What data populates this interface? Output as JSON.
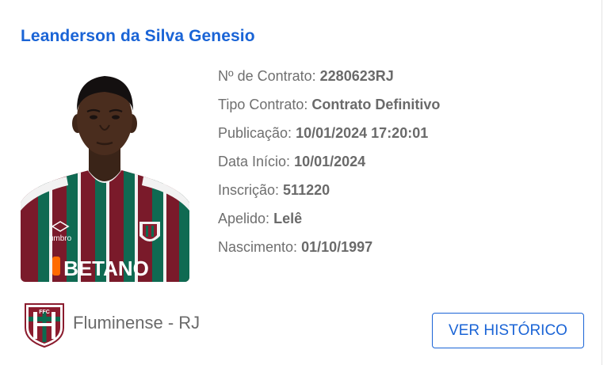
{
  "player": {
    "name": "Leanderson da Silva Genesio",
    "photo_alt": "Leanderson da Silva Genesio"
  },
  "info": [
    {
      "label": "Nº de Contrato:",
      "value": "2280623RJ"
    },
    {
      "label": "Tipo Contrato:",
      "value": "Contrato Definitivo"
    },
    {
      "label": "Publicação:",
      "value": "10/01/2024 17:20:01"
    },
    {
      "label": "Data Início:",
      "value": "10/01/2024"
    },
    {
      "label": "Inscrição:",
      "value": "511220"
    },
    {
      "label": "Apelido:",
      "value": "Lelê"
    },
    {
      "label": "Nascimento:",
      "value": "01/10/1997"
    }
  ],
  "club": {
    "name": "Fluminense - RJ",
    "crest_icon": "fluminense-crest-icon",
    "colors": {
      "maroon": "#8b1c2e",
      "green": "#0c6b4f",
      "white": "#ffffff"
    }
  },
  "actions": {
    "history_label": "VER HISTÓRICO"
  },
  "colors": {
    "accent": "#1a64d6",
    "text": "#6f6f6f"
  },
  "jersey": {
    "sponsor": "BETANO",
    "brand": "umbro"
  }
}
